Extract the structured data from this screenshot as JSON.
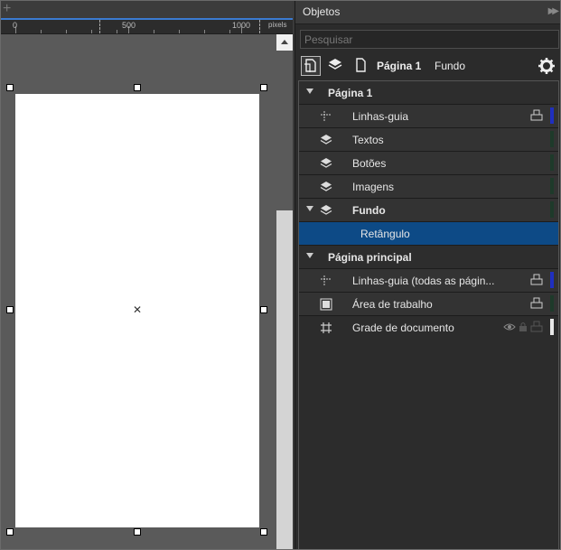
{
  "ruler": {
    "labels": [
      "0",
      "500",
      "1000"
    ],
    "unit": "pixels"
  },
  "panel": {
    "title": "Objetos",
    "search_placeholder": "Pesquisar",
    "toolbar": {
      "page_label": "Página 1",
      "layer_label": "Fundo"
    }
  },
  "tree": {
    "page1": "Página 1",
    "linhas_guia": "Linhas-guia",
    "textos": "Textos",
    "botoes": "Botões",
    "imagens": "Imagens",
    "fundo": "Fundo",
    "retangulo": "Retângulo",
    "master": "Página principal",
    "linhas_guia_todas": "Linhas-guia (todas as págin...",
    "area_trabalho": "Área de trabalho",
    "grade": "Grade de documento"
  },
  "colors": {
    "accent_blue": "#3b7bd1",
    "selection": "#0d4a86",
    "color_bar_blue": "#1f2fc0",
    "color_bar_dark": "#1e3a2a"
  }
}
